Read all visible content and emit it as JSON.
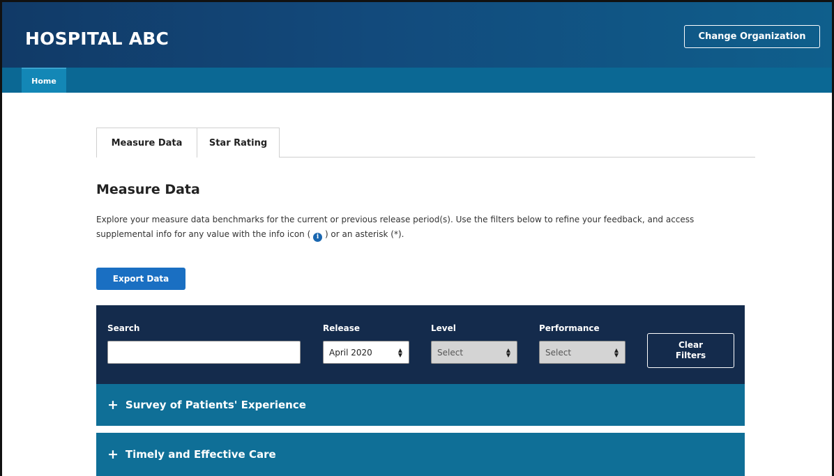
{
  "header": {
    "brand": "HOSPITAL ABC",
    "change_org_label": "Change Organization"
  },
  "nav": {
    "home_label": "Home"
  },
  "tabs": [
    {
      "label": "Measure Data",
      "active": true
    },
    {
      "label": "Star Rating",
      "active": false
    }
  ],
  "main": {
    "title": "Measure Data",
    "description_part1": "Explore your measure data benchmarks for the current or previous release period(s). Use the filters below to refine your feedback, and access supplemental info for any value with the info icon (",
    "description_part2": ") or an asterisk (*).",
    "info_icon_glyph": "i",
    "export_label": "Export Data"
  },
  "filters": {
    "search_label": "Search",
    "search_value": "",
    "release_label": "Release",
    "release_value": "April 2020",
    "level_label": "Level",
    "level_value": "Select",
    "performance_label": "Performance",
    "performance_value": "Select",
    "clear_label_line1": "Clear",
    "clear_label_line2": "Filters"
  },
  "sections": [
    {
      "label": "Survey of Patients' Experience",
      "icon": "plus-icon"
    },
    {
      "label": "Timely and Effective Care",
      "icon": "plus-icon"
    }
  ],
  "colors": {
    "header_dark": "#113a67",
    "nav_bar": "#0b6894",
    "export_button": "#1a6fc2",
    "filter_panel": "#142b4c",
    "accordion": "#0f6f97"
  }
}
